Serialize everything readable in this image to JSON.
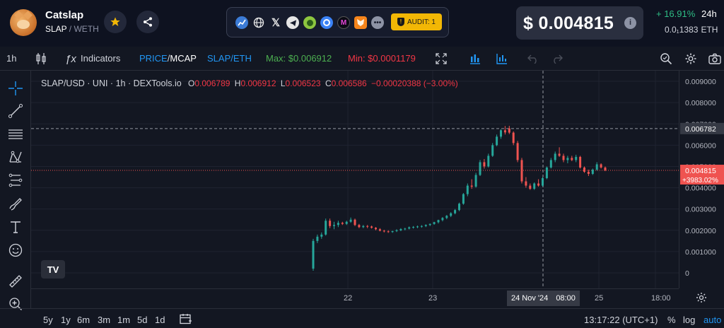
{
  "token": {
    "name": "Catslap",
    "pair_base": "SLAP",
    "pair_sep": " / ",
    "pair_quote": "WETH"
  },
  "links": [
    "chart-icon",
    "globe-icon",
    "x-icon",
    "telegram-icon",
    "coingecko-icon",
    "coinmarketcap-icon",
    "moralis-icon",
    "metamask-icon",
    "more-icon"
  ],
  "audit": {
    "label": "AUDIT: 1"
  },
  "price": {
    "value": "$ 0.004815",
    "change": "+ 16.91%",
    "period": "24h",
    "eth_value": "0.0₁1383",
    "eth_unit": "ETH"
  },
  "toolbar": {
    "interval": "1h",
    "indicators": "Indicators",
    "price_label": "PRICE",
    "mcap_label": "MCAP",
    "price_sep": "/",
    "pair": "SLAP/ETH",
    "max": "Max: $0.006912",
    "min": "Min: $0.0001179"
  },
  "legend": {
    "symbol": "SLAP/USD · UNI · 1h · DEXTools.io",
    "o_label": "O",
    "o": "0.006789",
    "h_label": "H",
    "h": "0.006912",
    "l_label": "L",
    "l": "0.006523",
    "c_label": "C",
    "c": "0.006586",
    "change": "−0.00020388 (−3.00%)"
  },
  "price_axis": {
    "ticks": [
      "0.009000",
      "0.008000",
      "0.007000",
      "0.006000",
      "0.005000",
      "0.004000",
      "0.003000",
      "0.002000",
      "0.001000",
      "0"
    ],
    "crosshair_label": "0.006782",
    "last_label": "0.004815",
    "last_pct": "+3983.02%"
  },
  "time_axis": {
    "ticks": [
      "22",
      "23",
      "25",
      "18:00"
    ],
    "crosshair_date": "24 Nov '24",
    "crosshair_time": "08:00"
  },
  "bottom": {
    "ranges": [
      "5y",
      "1y",
      "6m",
      "3m",
      "1m",
      "5d",
      "1d"
    ],
    "clock": "13:17:22 (UTC+1)",
    "pct": "%",
    "log": "log",
    "auto": "auto"
  },
  "colors": {
    "up": "#26a69a",
    "down": "#ef5350",
    "accent": "#2196f3",
    "max": "#4caf50",
    "min": "#f23645"
  },
  "chart_data": {
    "type": "candlestick",
    "series": [
      {
        "o": 0.0002,
        "h": 0.0016,
        "l": 0.0001,
        "c": 0.0015
      },
      {
        "o": 0.0015,
        "h": 0.0018,
        "l": 0.0014,
        "c": 0.0017
      },
      {
        "o": 0.0017,
        "h": 0.0019,
        "l": 0.0016,
        "c": 0.0018
      },
      {
        "o": 0.0018,
        "h": 0.00255,
        "l": 0.00175,
        "c": 0.00245
      },
      {
        "o": 0.00245,
        "h": 0.00255,
        "l": 0.0021,
        "c": 0.0022
      },
      {
        "o": 0.0022,
        "h": 0.0024,
        "l": 0.00205,
        "c": 0.00225
      },
      {
        "o": 0.00225,
        "h": 0.00245,
        "l": 0.00215,
        "c": 0.00235
      },
      {
        "o": 0.00235,
        "h": 0.0024,
        "l": 0.00225,
        "c": 0.0023
      },
      {
        "o": 0.0023,
        "h": 0.00245,
        "l": 0.00225,
        "c": 0.0024
      },
      {
        "o": 0.0024,
        "h": 0.0026,
        "l": 0.00235,
        "c": 0.0025
      },
      {
        "o": 0.0025,
        "h": 0.00255,
        "l": 0.0022,
        "c": 0.00225
      },
      {
        "o": 0.00225,
        "h": 0.0023,
        "l": 0.0021,
        "c": 0.00215
      },
      {
        "o": 0.00215,
        "h": 0.00225,
        "l": 0.0021,
        "c": 0.0022
      },
      {
        "o": 0.0022,
        "h": 0.00225,
        "l": 0.0021,
        "c": 0.00218
      },
      {
        "o": 0.00218,
        "h": 0.00222,
        "l": 0.00208,
        "c": 0.00212
      },
      {
        "o": 0.00212,
        "h": 0.00215,
        "l": 0.002,
        "c": 0.00205
      },
      {
        "o": 0.00205,
        "h": 0.0021,
        "l": 0.00195,
        "c": 0.00198
      },
      {
        "o": 0.00198,
        "h": 0.00202,
        "l": 0.0019,
        "c": 0.00195
      },
      {
        "o": 0.00195,
        "h": 0.002,
        "l": 0.00188,
        "c": 0.00192
      },
      {
        "o": 0.00192,
        "h": 0.00198,
        "l": 0.00188,
        "c": 0.00196
      },
      {
        "o": 0.00196,
        "h": 0.00205,
        "l": 0.00192,
        "c": 0.002
      },
      {
        "o": 0.002,
        "h": 0.0021,
        "l": 0.00196,
        "c": 0.00206
      },
      {
        "o": 0.00206,
        "h": 0.00212,
        "l": 0.002,
        "c": 0.00208
      },
      {
        "o": 0.00208,
        "h": 0.00218,
        "l": 0.00204,
        "c": 0.00214
      },
      {
        "o": 0.00214,
        "h": 0.0022,
        "l": 0.00208,
        "c": 0.00216
      },
      {
        "o": 0.00216,
        "h": 0.00222,
        "l": 0.0021,
        "c": 0.00218
      },
      {
        "o": 0.00218,
        "h": 0.00224,
        "l": 0.00212,
        "c": 0.0022
      },
      {
        "o": 0.0022,
        "h": 0.00228,
        "l": 0.00215,
        "c": 0.00225
      },
      {
        "o": 0.00225,
        "h": 0.00232,
        "l": 0.0022,
        "c": 0.0023
      },
      {
        "o": 0.0023,
        "h": 0.0024,
        "l": 0.00226,
        "c": 0.00238
      },
      {
        "o": 0.00238,
        "h": 0.0025,
        "l": 0.00232,
        "c": 0.00248
      },
      {
        "o": 0.00248,
        "h": 0.00262,
        "l": 0.00242,
        "c": 0.00258
      },
      {
        "o": 0.00258,
        "h": 0.00272,
        "l": 0.00252,
        "c": 0.00268
      },
      {
        "o": 0.00268,
        "h": 0.00285,
        "l": 0.00262,
        "c": 0.0028
      },
      {
        "o": 0.0028,
        "h": 0.003,
        "l": 0.00275,
        "c": 0.00295
      },
      {
        "o": 0.00295,
        "h": 0.0033,
        "l": 0.0029,
        "c": 0.00325
      },
      {
        "o": 0.00325,
        "h": 0.00375,
        "l": 0.0032,
        "c": 0.0037
      },
      {
        "o": 0.0037,
        "h": 0.0042,
        "l": 0.0036,
        "c": 0.0041
      },
      {
        "o": 0.0041,
        "h": 0.0044,
        "l": 0.00395,
        "c": 0.00405
      },
      {
        "o": 0.00405,
        "h": 0.0047,
        "l": 0.004,
        "c": 0.0046
      },
      {
        "o": 0.0046,
        "h": 0.0053,
        "l": 0.00455,
        "c": 0.0052
      },
      {
        "o": 0.0052,
        "h": 0.00535,
        "l": 0.0049,
        "c": 0.005
      },
      {
        "o": 0.005,
        "h": 0.0056,
        "l": 0.00495,
        "c": 0.0055
      },
      {
        "o": 0.0055,
        "h": 0.0061,
        "l": 0.00545,
        "c": 0.006
      },
      {
        "o": 0.006,
        "h": 0.0065,
        "l": 0.00595,
        "c": 0.0064
      },
      {
        "o": 0.0064,
        "h": 0.00675,
        "l": 0.0063,
        "c": 0.0067
      },
      {
        "o": 0.0067,
        "h": 0.0069,
        "l": 0.0065,
        "c": 0.0066
      },
      {
        "o": 0.00679,
        "h": 0.00691,
        "l": 0.00652,
        "c": 0.00659
      },
      {
        "o": 0.00659,
        "h": 0.00665,
        "l": 0.006,
        "c": 0.0061
      },
      {
        "o": 0.0061,
        "h": 0.0062,
        "l": 0.0052,
        "c": 0.0053
      },
      {
        "o": 0.0053,
        "h": 0.0054,
        "l": 0.0042,
        "c": 0.0043
      },
      {
        "o": 0.0043,
        "h": 0.0045,
        "l": 0.004,
        "c": 0.0041
      },
      {
        "o": 0.0041,
        "h": 0.0042,
        "l": 0.0039,
        "c": 0.00395
      },
      {
        "o": 0.00395,
        "h": 0.00425,
        "l": 0.0039,
        "c": 0.0042
      },
      {
        "o": 0.0042,
        "h": 0.0044,
        "l": 0.00405,
        "c": 0.0041
      },
      {
        "o": 0.0041,
        "h": 0.0045,
        "l": 0.00405,
        "c": 0.00445
      },
      {
        "o": 0.00445,
        "h": 0.005,
        "l": 0.0044,
        "c": 0.00495
      },
      {
        "o": 0.00495,
        "h": 0.0054,
        "l": 0.0049,
        "c": 0.0053
      },
      {
        "o": 0.0053,
        "h": 0.0057,
        "l": 0.0052,
        "c": 0.0056
      },
      {
        "o": 0.0056,
        "h": 0.0059,
        "l": 0.00545,
        "c": 0.0055
      },
      {
        "o": 0.0055,
        "h": 0.0056,
        "l": 0.0052,
        "c": 0.0053
      },
      {
        "o": 0.0053,
        "h": 0.0055,
        "l": 0.00515,
        "c": 0.0054
      },
      {
        "o": 0.0054,
        "h": 0.0055,
        "l": 0.00525,
        "c": 0.0053
      },
      {
        "o": 0.0053,
        "h": 0.00555,
        "l": 0.0052,
        "c": 0.00545
      },
      {
        "o": 0.00545,
        "h": 0.0055,
        "l": 0.0049,
        "c": 0.00495
      },
      {
        "o": 0.00495,
        "h": 0.005,
        "l": 0.0047,
        "c": 0.00475
      },
      {
        "o": 0.00475,
        "h": 0.00485,
        "l": 0.00455,
        "c": 0.00465
      },
      {
        "o": 0.00465,
        "h": 0.0049,
        "l": 0.0046,
        "c": 0.00485
      },
      {
        "o": 0.00485,
        "h": 0.0052,
        "l": 0.0048,
        "c": 0.0051
      },
      {
        "o": 0.0051,
        "h": 0.00515,
        "l": 0.0049,
        "c": 0.00495
      },
      {
        "o": 0.00495,
        "h": 0.005,
        "l": 0.00478,
        "c": 0.00482
      }
    ],
    "ylim": [
      0,
      0.0094
    ],
    "last_price": 0.004815,
    "crosshair_price": 0.006782
  }
}
